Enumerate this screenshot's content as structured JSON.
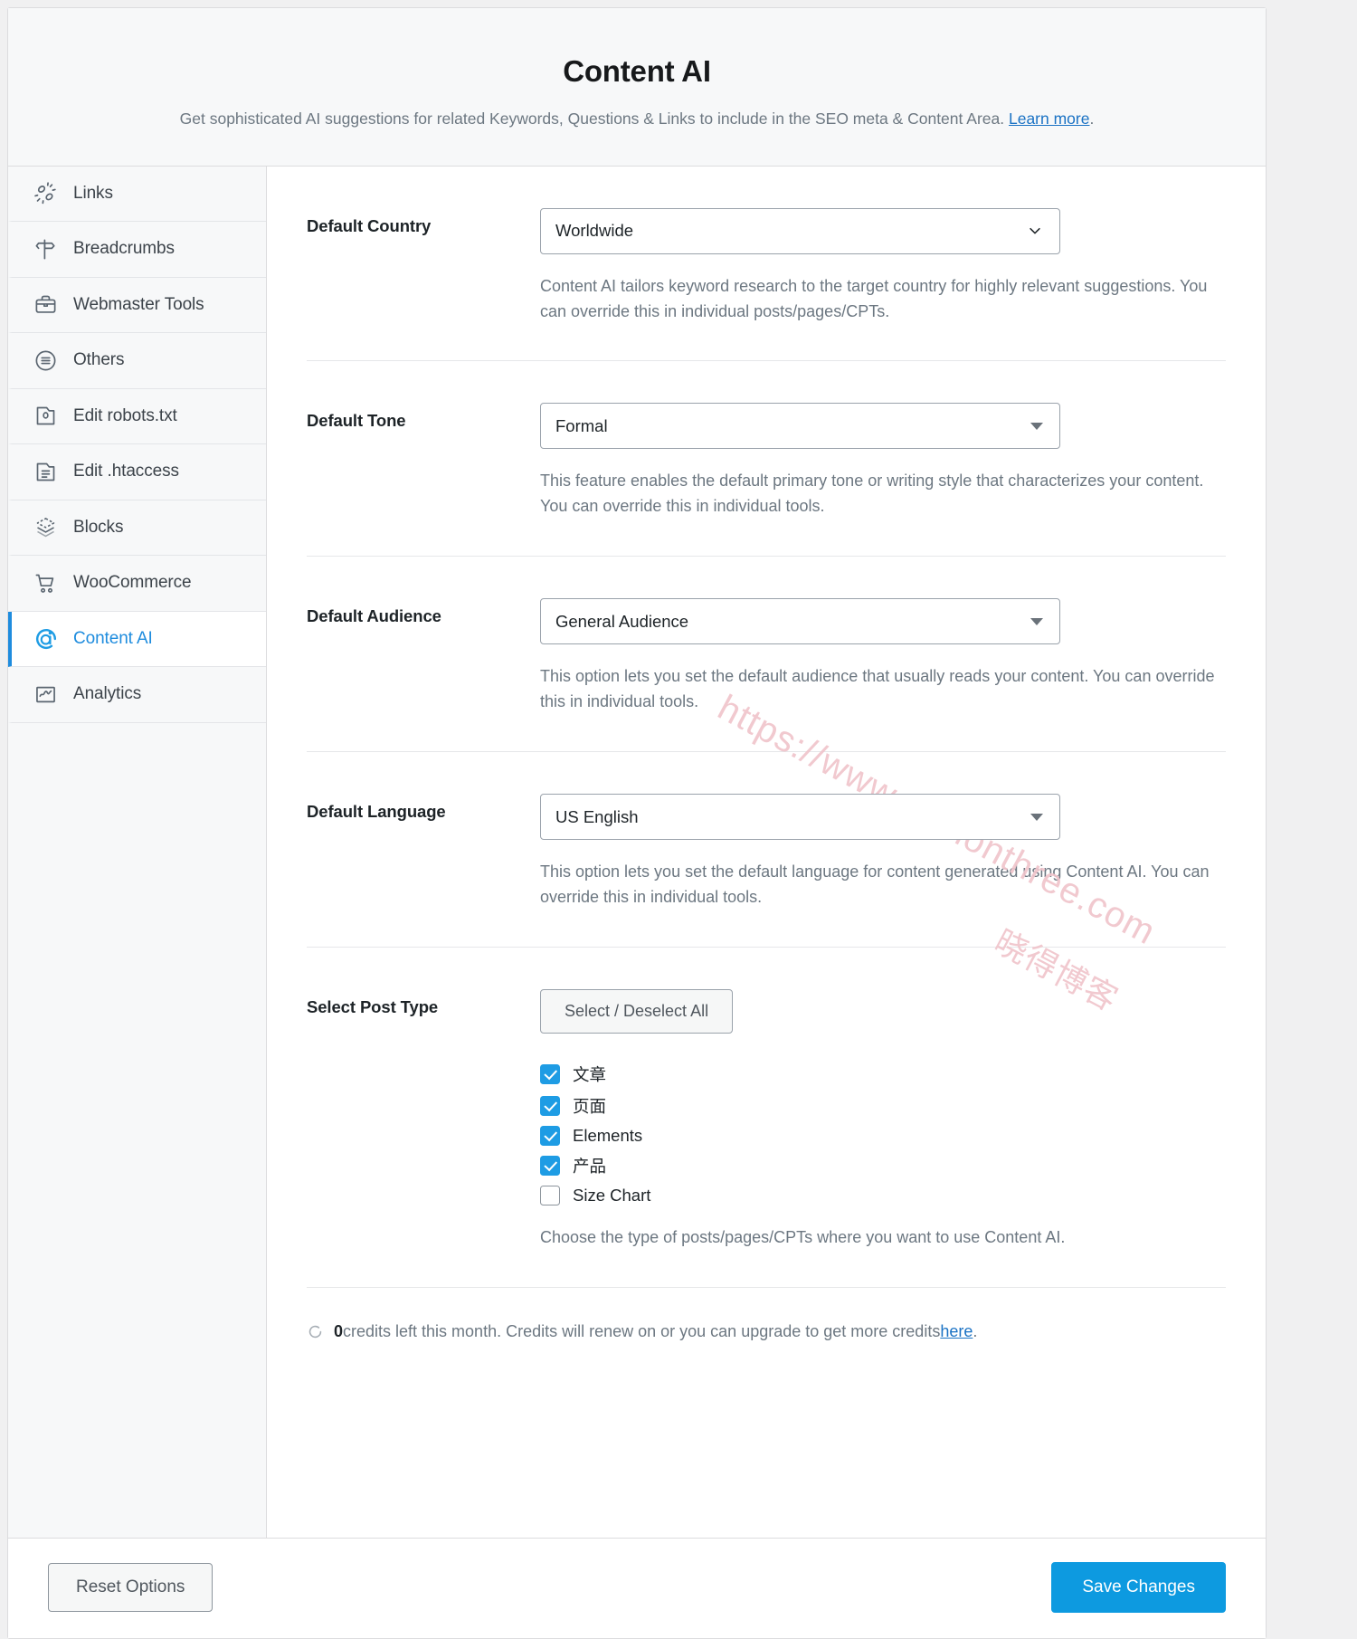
{
  "header": {
    "title": "Content AI",
    "subtitle_before": "Get sophisticated AI suggestions for related Keywords, Questions & Links to include in the SEO meta & Content Area. ",
    "subtitle_link": "Learn more",
    "subtitle_after": "."
  },
  "sidebar": {
    "items": [
      {
        "label": "Links",
        "icon": "links-icon",
        "active": false
      },
      {
        "label": "Breadcrumbs",
        "icon": "signpost-icon",
        "active": false
      },
      {
        "label": "Webmaster Tools",
        "icon": "briefcase-icon",
        "active": false
      },
      {
        "label": "Others",
        "icon": "list-circle-icon",
        "active": false
      },
      {
        "label": "Edit robots.txt",
        "icon": "robots-file-icon",
        "active": false
      },
      {
        "label": "Edit .htaccess",
        "icon": "document-lines-icon",
        "active": false
      },
      {
        "label": "Blocks",
        "icon": "blocks-layers-icon",
        "active": false
      },
      {
        "label": "WooCommerce",
        "icon": "shopping-cart-icon",
        "active": false
      },
      {
        "label": "Content AI",
        "icon": "content-ai-icon",
        "active": true
      },
      {
        "label": "Analytics",
        "icon": "analytics-chart-icon",
        "active": false
      }
    ]
  },
  "fields": {
    "country": {
      "label": "Default Country",
      "value": "Worldwide",
      "help": "Content AI tailors keyword research to the target country for highly relevant suggestions. You can override this in individual posts/pages/CPTs."
    },
    "tone": {
      "label": "Default Tone",
      "value": "Formal",
      "help": "This feature enables the default primary tone or writing style that characterizes your content. You can override this in individual tools."
    },
    "audience": {
      "label": "Default Audience",
      "value": "General Audience",
      "help": "This option lets you set the default audience that usually reads your content. You can override this in individual tools."
    },
    "language": {
      "label": "Default Language",
      "value": "US English",
      "help": "This option lets you set the default language for content generated using Content AI. You can override this in individual tools."
    },
    "post_type": {
      "label": "Select Post Type",
      "toggle_all_label": "Select / Deselect All",
      "help": "Choose the type of posts/pages/CPTs where you want to use Content AI.",
      "options": [
        {
          "label": "文章",
          "checked": true
        },
        {
          "label": "页面",
          "checked": true
        },
        {
          "label": "Elements",
          "checked": true
        },
        {
          "label": "产品",
          "checked": true
        },
        {
          "label": "Size Chart",
          "checked": false
        }
      ]
    }
  },
  "credits": {
    "count": "0",
    "text_before": " credits left this month. Credits will renew on or you can upgrade to get more credits ",
    "link": "here",
    "text_after": ".",
    "icon": "refresh-icon"
  },
  "footer": {
    "reset_label": "Reset Options",
    "save_label": "Save Changes"
  },
  "watermark": {
    "line1": "https://www.pythonthree.com",
    "line2": "晓得博客"
  },
  "colors": {
    "accent": "#1e8cde",
    "save_button": "#0d9ae0",
    "checkbox": "#1e9ce4",
    "link": "#1a72c4",
    "watermark": "#f0c5cc"
  }
}
